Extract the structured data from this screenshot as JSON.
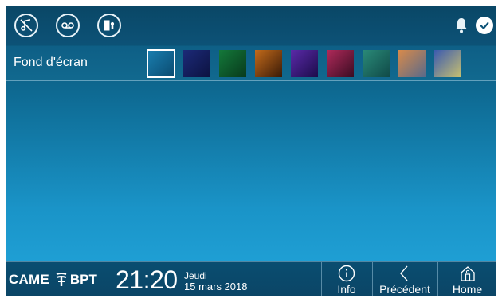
{
  "topbar": {
    "icons": [
      "do-not-disturb-icon",
      "answering-machine-icon",
      "door-status-icon",
      "bell-icon",
      "check-icon"
    ]
  },
  "wallpaper": {
    "label": "Fond d'écran",
    "swatches": [
      {
        "name": "wallpaper-swatch-1",
        "from": "#1a7fb0",
        "to": "#0a4a6f",
        "selected": true
      },
      {
        "name": "wallpaper-swatch-2",
        "from": "#1c2a78",
        "to": "#0c1240",
        "selected": false
      },
      {
        "name": "wallpaper-swatch-3",
        "from": "#14783a",
        "to": "#083a1c",
        "selected": false
      },
      {
        "name": "wallpaper-swatch-4",
        "from": "#c26a1a",
        "to": "#3a1a08",
        "selected": false
      },
      {
        "name": "wallpaper-swatch-5",
        "from": "#5a2aa8",
        "to": "#1c0c4a",
        "selected": false
      },
      {
        "name": "wallpaper-swatch-6",
        "from": "#b02a5a",
        "to": "#3a0c22",
        "selected": false
      },
      {
        "name": "wallpaper-swatch-7",
        "from": "#2a8a78",
        "to": "#104a48",
        "selected": false
      },
      {
        "name": "wallpaper-swatch-8",
        "from": "#d88a4a",
        "to": "#5a6a8a",
        "selected": false
      },
      {
        "name": "wallpaper-swatch-9",
        "from": "#3a5ab0",
        "to": "#c8c070",
        "selected": false
      }
    ]
  },
  "bottombar": {
    "brand_left": "CAME",
    "brand_right": "BPT",
    "time": "21:20",
    "day": "Jeudi",
    "date": "15 mars 2018",
    "info_label": "Info",
    "back_label": "Précédent",
    "home_label": "Home"
  },
  "colors": {
    "accent": "#ffffff",
    "background_top": "#0a4a6b",
    "background_bottom": "#22a6dc"
  }
}
